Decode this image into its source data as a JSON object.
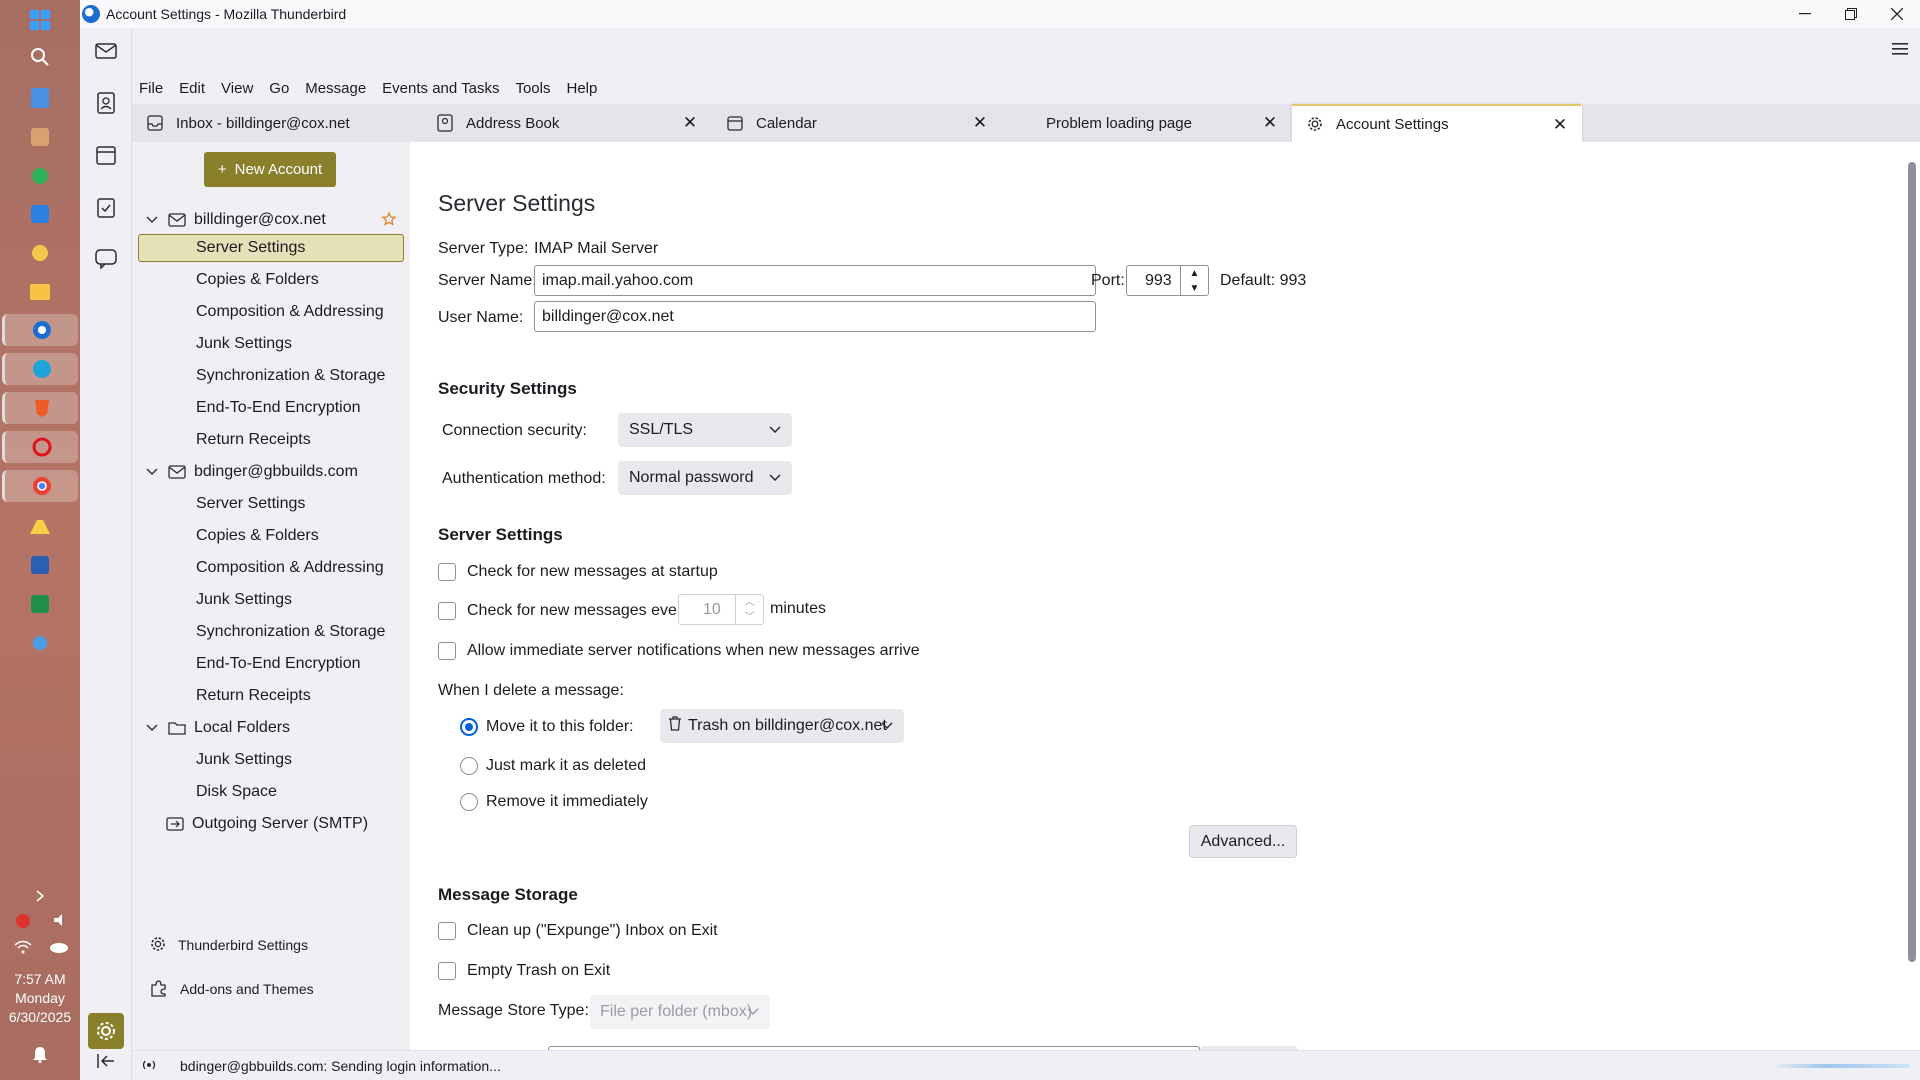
{
  "window": {
    "title": "Account Settings - Mozilla Thunderbird"
  },
  "taskbar": {
    "time": "7:57 AM",
    "day": "Monday",
    "date": "6/30/2025"
  },
  "menubar": {
    "items": [
      "File",
      "Edit",
      "View",
      "Go",
      "Message",
      "Events and Tasks",
      "Tools",
      "Help"
    ]
  },
  "tabs": [
    {
      "label": "Inbox - billdinger@cox.net",
      "icon": "inbox-icon",
      "closable": false,
      "selected": false
    },
    {
      "label": "Address Book",
      "icon": "address-book-icon",
      "closable": true,
      "selected": false
    },
    {
      "label": "Calendar",
      "icon": "calendar-icon",
      "closable": true,
      "selected": false
    },
    {
      "label": "Problem loading page",
      "icon": "",
      "closable": true,
      "selected": false
    },
    {
      "label": "Account Settings",
      "icon": "settings-icon",
      "closable": true,
      "selected": true
    }
  ],
  "sidebar": {
    "new_account_label": "New Account",
    "accounts": [
      {
        "name": "billdinger@cox.net",
        "items": [
          "Server Settings",
          "Copies & Folders",
          "Composition & Addressing",
          "Junk Settings",
          "Synchronization & Storage",
          "End-To-End Encryption",
          "Return Receipts"
        ]
      },
      {
        "name": "bdinger@gbbuilds.com",
        "items": [
          "Server Settings",
          "Copies & Folders",
          "Composition & Addressing",
          "Junk Settings",
          "Synchronization & Storage",
          "End-To-End Encryption",
          "Return Receipts"
        ]
      },
      {
        "name": "Local Folders",
        "items": [
          "Junk Settings",
          "Disk Space"
        ]
      }
    ],
    "outgoing_server": "Outgoing Server (SMTP)",
    "footer": {
      "settings_label": "Thunderbird Settings",
      "addons_label": "Add-ons and Themes"
    }
  },
  "main": {
    "title": "Server Settings",
    "server_type_label": "Server Type:",
    "server_type_value": "IMAP Mail Server",
    "server_name_label": "Server Name:",
    "server_name_value": "imap.mail.yahoo.com",
    "port_label": "Port:",
    "port_value": "993",
    "default_label": "Default: 993",
    "user_name_label": "User Name:",
    "user_name_value": "billdinger@cox.net",
    "security_heading": "Security Settings",
    "connection_security_label": "Connection security:",
    "connection_security_value": "SSL/TLS",
    "auth_method_label": "Authentication method:",
    "auth_method_value": "Normal password",
    "server_settings_heading": "Server Settings",
    "check_startup_label": "Check for new messages at startup",
    "check_every_label": "Check for new messages every",
    "check_every_value": "10",
    "minutes_label": "minutes",
    "allow_notifications_label": "Allow immediate server notifications when new messages arrive",
    "delete_heading": "When I delete a message:",
    "move_folder_label": "Move it to this folder:",
    "trash_folder_value": "Trash on billdinger@cox.net",
    "mark_deleted_label": "Just mark it as deleted",
    "remove_immediately_label": "Remove it immediately",
    "advanced_button": "Advanced...",
    "storage_heading": "Message Storage",
    "expunge_label": "Clean up (\"Expunge\") Inbox on Exit",
    "empty_trash_label": "Empty Trash on Exit",
    "store_type_label": "Message Store Type:",
    "store_type_value": "File per folder (mbox)"
  },
  "status": {
    "text": "bdinger@gbbuilds.com: Sending login information..."
  },
  "colors": {
    "accent": "#8a7f2b",
    "selection_bg": "#e5e0b8",
    "radio_blue": "#0060df"
  }
}
